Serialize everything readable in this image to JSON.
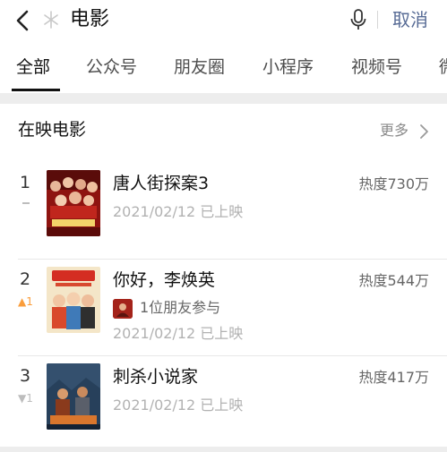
{
  "search": {
    "query": "电影",
    "cancel_label": "取消"
  },
  "tabs": [
    {
      "label": "全部",
      "active": true
    },
    {
      "label": "公众号"
    },
    {
      "label": "朋友圈"
    },
    {
      "label": "小程序"
    },
    {
      "label": "视频号"
    },
    {
      "label": "微"
    }
  ],
  "section": {
    "title": "在映电影",
    "more_label": "更多"
  },
  "movies": [
    {
      "rank": "1",
      "trend": "flat",
      "title": "唐人街探案3",
      "heat": "热度730万",
      "date": "2021/02/12 已上映"
    },
    {
      "rank": "2",
      "trend": "up",
      "trend_label": "▲1",
      "title": "你好，李焕英",
      "heat": "热度544万",
      "friend_text": "1位朋友参与",
      "date": "2021/02/12 已上映"
    },
    {
      "rank": "3",
      "trend": "down",
      "trend_label": "▼1",
      "title": "刺杀小说家",
      "heat": "热度417万",
      "date": "2021/02/12 已上映"
    }
  ],
  "colors": {
    "link_blue": "#576b95",
    "trend_up": "#fa9d3b",
    "background": "#ededed"
  }
}
